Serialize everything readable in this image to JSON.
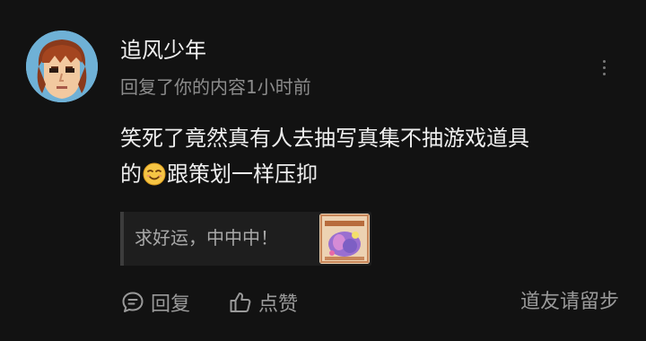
{
  "comment": {
    "username": "追风少年",
    "subline": "回复了你的内容1小时前",
    "text_line1": "笑死了竟然真有人去抽写真集不抽游戏道具",
    "text_line2_before": "的",
    "text_line2_after": "跟策划一样压抑",
    "emoji": "smiling-face-emoji"
  },
  "quote": {
    "text": "求好运，中中中！"
  },
  "actions": {
    "reply_label": "回复",
    "like_label": "点赞"
  },
  "footer": {
    "note": "道友请留步"
  },
  "colors": {
    "background": "#121212",
    "primary_text": "#eeeeee",
    "secondary_text": "#8c8c8c",
    "quote_background": "#1e1e1e"
  },
  "icons": {
    "more": "vertical-dots-icon",
    "reply": "chat-bubble-icon",
    "like": "thumbs-up-icon"
  }
}
